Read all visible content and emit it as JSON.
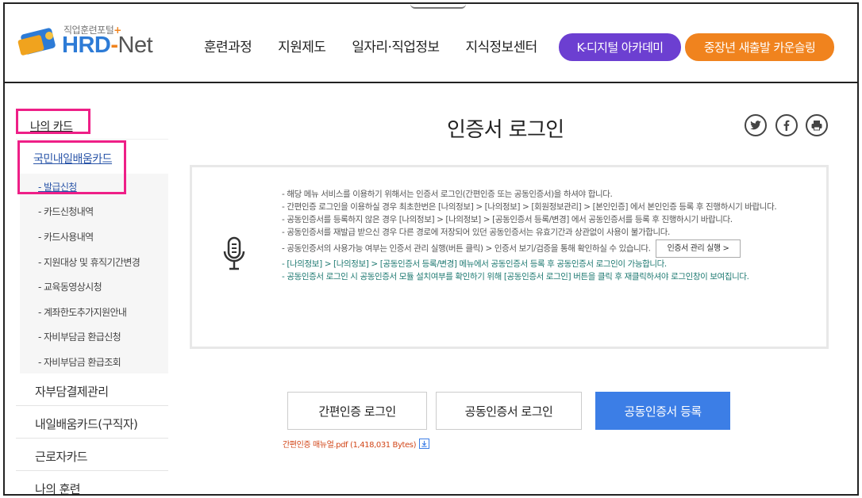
{
  "header": {
    "logo_sub": "직업훈련포털",
    "logo_plus": "+",
    "logo_hrd": "HRD",
    "logo_dash": "-",
    "logo_net": "Net",
    "nav": [
      "훈련과정",
      "지원제도",
      "일자리·직업정보",
      "지식정보센터"
    ],
    "btn_k": "K-디지털 아카데미",
    "btn_mid": "중장년 새출발 카운슬링",
    "colors": {
      "k_button": "#6c3fd1",
      "mid_button": "#f0831e",
      "brand_blue": "#2d7bd6"
    }
  },
  "sidebar": {
    "title": "나의 카드",
    "category": "국민내일배움카드",
    "sub_items": [
      "- 발급신청",
      "- 카드신청내역",
      "- 카드사용내역",
      "- 지원대상 및 휴직기간변경",
      "- 교육동영상시청",
      "- 계좌한도추가지원안내",
      "- 자비부담금 환급신청",
      "- 자비부담금 환급조회"
    ],
    "main_items": [
      "자부담결제관리",
      "내일배움카드(구직자)",
      "근로자카드",
      "나의 훈련"
    ],
    "highlight_color": "#ee1f87"
  },
  "content": {
    "title": "인증서 로그인",
    "share_icons": [
      "twitter-icon",
      "facebook-icon",
      "print-icon"
    ],
    "info": [
      "- 해당 메뉴 서비스를 이용하기 위해서는 인증서 로그인(간편인증 또는 공동인증서)을 하셔야 합니다.",
      "- 간편인증 로그인을 이용하실 경우 최초한번은 [나의정보] > [나의정보] > [회원정보관리] > [본인인증] 에서 본인인증 등록 후 진행하시기 바랍니다.",
      "- 공동인증서를 등록하지 않은 경우 [나의정보] > [나의정보] > [공동인증서 등록/변경] 에서 공동인증서를 등록 후 진행하시기 바랍니다.",
      "- 공동인증서를 재발급 받으신 경우 다른 경로에 저장되어 있던 공동인증서는 유효기간과 상관없이 사용이 불가합니다.",
      "- 공동인증서의 사용가능 여부는 인증서 관리 실행(버튼 클릭) > 인증서 보기/검증을 통해 확인하실 수 있습니다."
    ],
    "info_green": [
      "- [나의정보] > [나의정보] > [공동인증서 등록/변경] 메뉴에서 공동인증서 등록 후 공동인증서 로그인이 가능합니다.",
      "- 공동인증서 로그인 시 공동인증서 모듈 설치여부를 확인하기 위해 [공동인증서 로그인] 버튼을 클릭 후 재클릭하셔야 로그인창이 보여집니다."
    ],
    "mgr_button": "인증서 관리 실행 >",
    "btn_simple": "간편인증 로그인",
    "btn_cert": "공동인증서 로그인",
    "btn_register": "공동인증서 등록",
    "manual": "간편인증 매뉴얼.pdf (1,418,031 Bytes)",
    "accent_blue": "#3c7ee6"
  }
}
